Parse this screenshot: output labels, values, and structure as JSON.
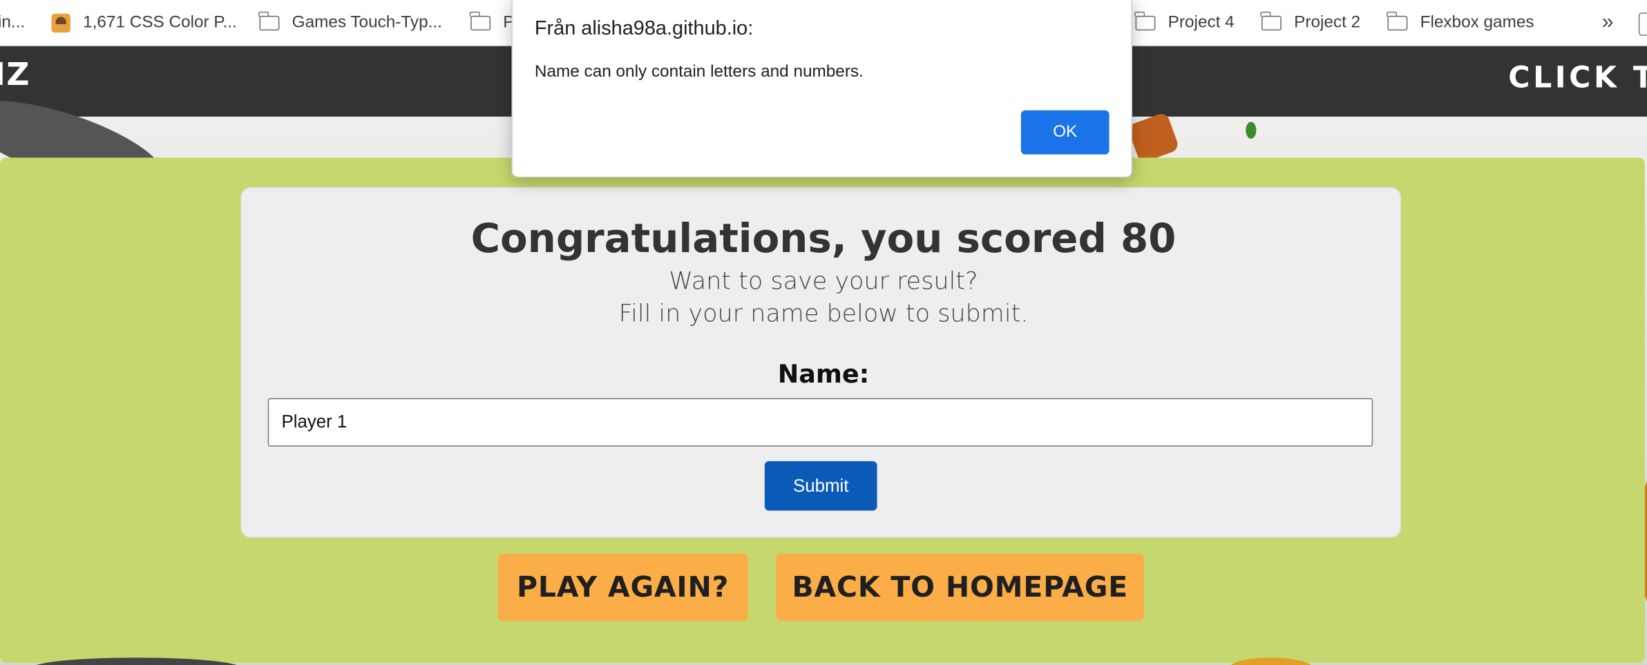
{
  "bookmarks": {
    "items": [
      {
        "label": "in...",
        "icon": ""
      },
      {
        "label": "1,671 CSS Color P...",
        "icon": "avatar-icon"
      },
      {
        "label": "Games Touch-Typ...",
        "icon": "folder-icon"
      },
      {
        "label": "P",
        "icon": "folder-icon"
      },
      {
        "label": "Project 4",
        "icon": "folder-icon"
      },
      {
        "label": "Project 2",
        "icon": "folder-icon"
      },
      {
        "label": "Flexbox games",
        "icon": "folder-icon"
      }
    ],
    "overflow": "»"
  },
  "header": {
    "logo": "IZ",
    "nav_link": "CLICK TO"
  },
  "result": {
    "title": "Congratulations, you scored 80",
    "line1": "Want to save your result?",
    "line2": "Fill in your name below to submit.",
    "name_label": "Name:",
    "name_value": "Player 1",
    "submit_label": "Submit"
  },
  "actions": {
    "play_again": "PLAY AGAIN?",
    "back_home": "BACK TO HOMEPAGE"
  },
  "dialog": {
    "title": "Från alisha98a.github.io:",
    "message": "Name can only contain letters and numbers.",
    "ok_label": "OK"
  },
  "colors": {
    "header_bg": "#333333",
    "panel_green": "#c5d86d",
    "card_bg": "#eeeeee",
    "submit_blue": "#0a5bb8",
    "orange_button": "#fbad48",
    "dialog_ok_blue": "#1a73e8"
  }
}
